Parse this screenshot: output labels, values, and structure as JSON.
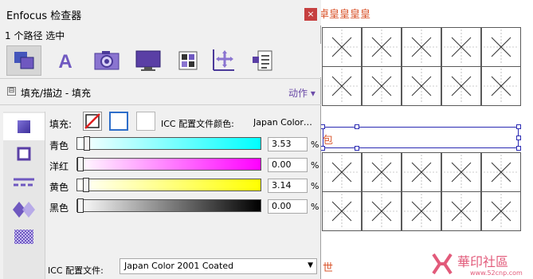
{
  "window": {
    "title": "Enfocus 检查器",
    "close_label": "×",
    "subtitle": "1 个路径 选中"
  },
  "toolbar": {
    "tools": [
      {
        "name": "object-tool",
        "icon": "overlapping-squares-icon",
        "active": true
      },
      {
        "name": "text-tool",
        "icon": "letter-a-icon",
        "active": false
      },
      {
        "name": "image-tool",
        "icon": "camera-icon",
        "active": false
      },
      {
        "name": "page-tool",
        "icon": "monitor-icon",
        "active": false
      },
      {
        "name": "color-tool",
        "icon": "color-grid-icon",
        "active": false
      },
      {
        "name": "position-tool",
        "icon": "move-axes-icon",
        "active": false
      },
      {
        "name": "document-tool",
        "icon": "document-list-icon",
        "active": false
      }
    ]
  },
  "section": {
    "collapse_icon": "⊟",
    "title": "填充/描边 - 填充",
    "actions_label": "动作 ▾"
  },
  "sidebar": {
    "items": [
      {
        "name": "fill-tab",
        "icon": "filled-square-icon",
        "active": true
      },
      {
        "name": "stroke-tab",
        "icon": "outlined-square-icon",
        "active": false
      },
      {
        "name": "dash-tab",
        "icon": "dashed-lines-icon",
        "active": false
      },
      {
        "name": "blend-tab",
        "icon": "diamond-blend-icon",
        "active": false
      },
      {
        "name": "pattern-tab",
        "icon": "checker-pattern-icon",
        "active": false
      }
    ]
  },
  "fill": {
    "label": "填充:",
    "swatches": [
      "no-fill-swatch",
      "blue-outline-swatch",
      "white-swatch"
    ],
    "icc_color_label": "ICC 配置文件颜色:",
    "icc_color_value": "Japan Color…",
    "channels": [
      {
        "label": "青色",
        "value": "3.53",
        "fraction": 0.0353,
        "gradient_end": "#00ffff",
        "unit": "%"
      },
      {
        "label": "洋红",
        "value": "0.00",
        "fraction": 0.0,
        "gradient_end": "#ff00ff",
        "unit": "%"
      },
      {
        "label": "黄色",
        "value": "3.14",
        "fraction": 0.0314,
        "gradient_end": "#ffff00",
        "unit": "%"
      },
      {
        "label": "黑色",
        "value": "0.00",
        "fraction": 0.0,
        "gradient_end": "#000000",
        "unit": "%"
      }
    ],
    "icc_profile_label": "ICC 配置文件:",
    "icc_profile_value": "Japan Color 2001 Coated"
  },
  "document": {
    "header_text": "卓皇皇皇皇",
    "middle_text": "包",
    "footer_text": "世",
    "watermark_text": "華印社區",
    "watermark_url": "www.52cnp.com"
  },
  "colors": {
    "accent_purple": "#6b4ba8",
    "selection_blue": "#2b2bb3",
    "doc_text_red": "#d9542b"
  }
}
